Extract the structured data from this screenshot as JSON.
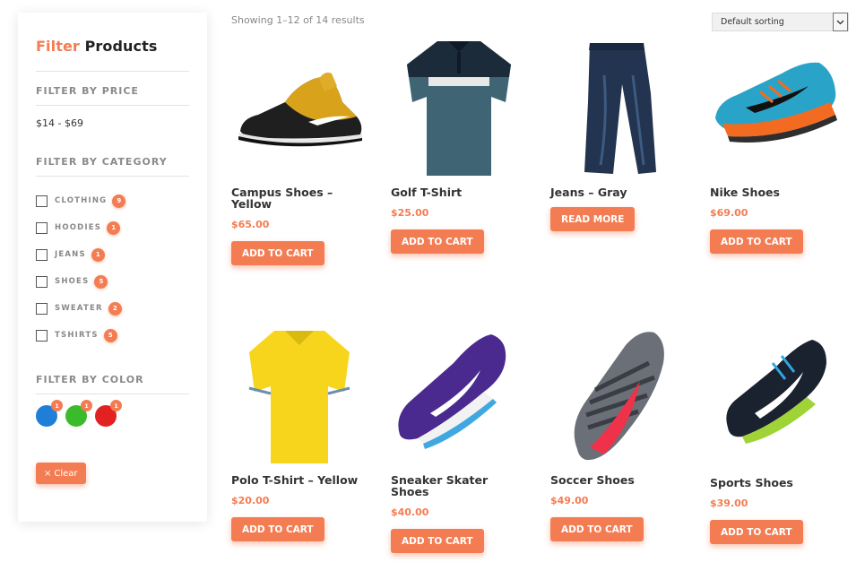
{
  "sidebar": {
    "title_accent": "Filter",
    "title_rest": "Products",
    "price_heading": "FILTER BY PRICE",
    "price_range": "$14 - $69",
    "category_heading": "FILTER BY CATEGORY",
    "categories": [
      {
        "label": "CLOTHING",
        "count": "9"
      },
      {
        "label": "HOODIES",
        "count": "1"
      },
      {
        "label": "JEANS",
        "count": "1"
      },
      {
        "label": "SHOES",
        "count": "5"
      },
      {
        "label": "SWEATER",
        "count": "2"
      },
      {
        "label": "TSHIRTS",
        "count": "5"
      }
    ],
    "color_heading": "FILTER BY COLOR",
    "colors": [
      {
        "name": "blue",
        "hex": "#1f7fd8",
        "count": "1"
      },
      {
        "name": "green",
        "hex": "#3bbb2a",
        "count": "1"
      },
      {
        "name": "red",
        "hex": "#e22222",
        "count": "1"
      }
    ],
    "clear_label": "Clear"
  },
  "toolbar": {
    "results_text": "Showing 1–12 of 14 results",
    "sort_selected": "Default sorting"
  },
  "products": [
    {
      "name": "Campus Shoes – Yellow",
      "price": "$65.00",
      "button": "ADD TO CART"
    },
    {
      "name": "Golf T-Shirt",
      "price": "$25.00",
      "button": "ADD TO CART"
    },
    {
      "name": "Jeans – Gray",
      "price": "",
      "button": "READ MORE"
    },
    {
      "name": "Nike Shoes",
      "price": "$69.00",
      "button": "ADD TO CART"
    },
    {
      "name": "Polo T-Shirt – Yellow",
      "price": "$20.00",
      "button": "ADD TO CART"
    },
    {
      "name": "Sneaker Skater Shoes",
      "price": "$40.00",
      "button": "ADD TO CART"
    },
    {
      "name": "Soccer Shoes",
      "price": "$49.00",
      "button": "ADD TO CART"
    },
    {
      "name": "Sports Shoes",
      "price": "$39.00",
      "button": "ADD TO CART"
    }
  ],
  "theme": {
    "accent": "#f47c52"
  }
}
